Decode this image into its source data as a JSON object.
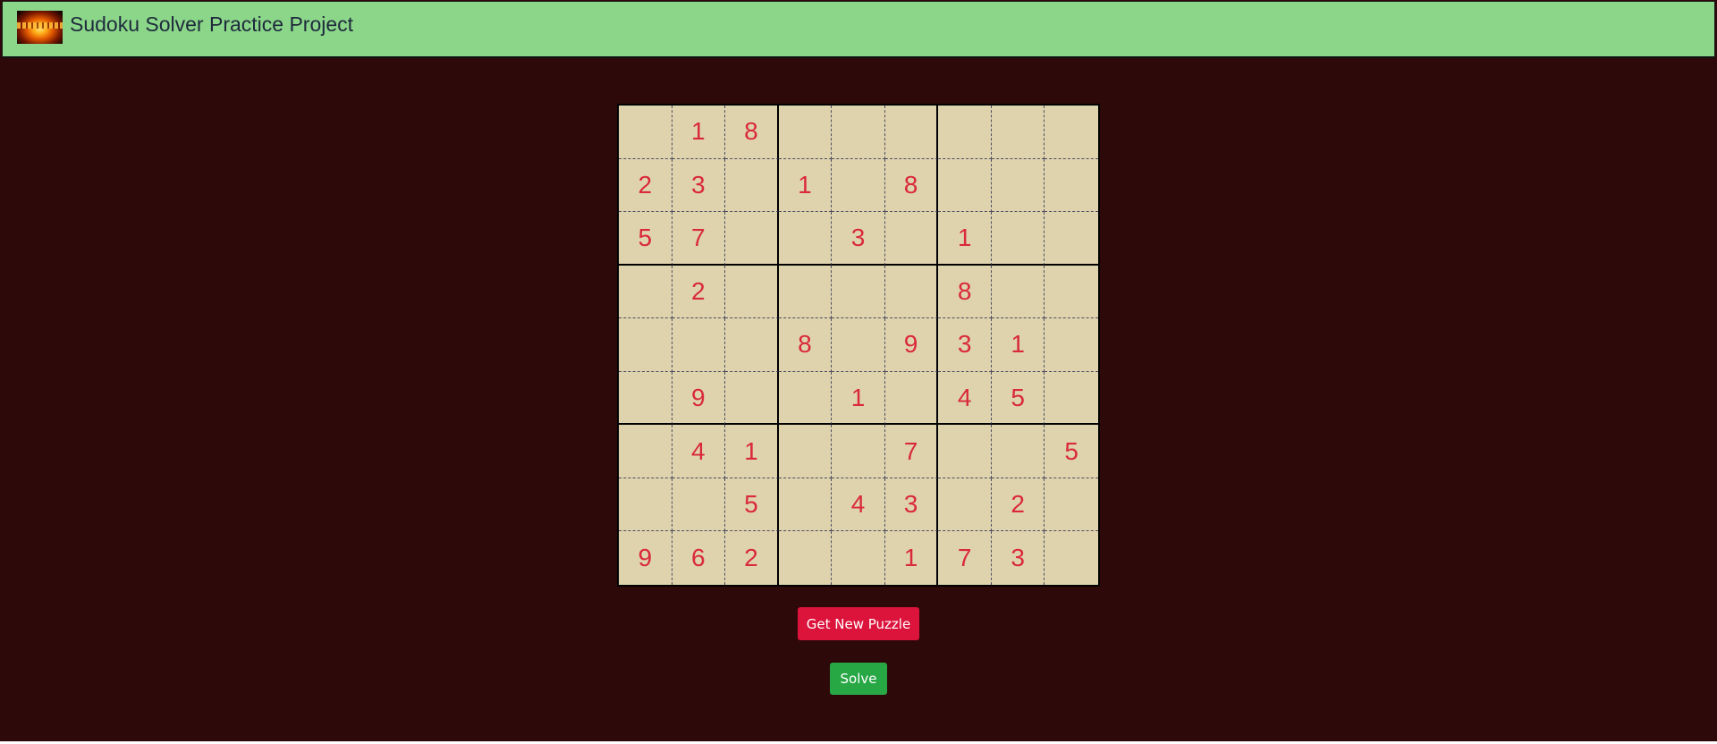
{
  "header": {
    "title": "Sudoku Solver Practice Project",
    "logo_icon": "fire-logo-icon"
  },
  "grid": [
    [
      "",
      "1",
      "8",
      "",
      "",
      "",
      "",
      "",
      ""
    ],
    [
      "2",
      "3",
      "",
      "1",
      "",
      "8",
      "",
      "",
      ""
    ],
    [
      "5",
      "7",
      "",
      "",
      "3",
      "",
      "1",
      "",
      ""
    ],
    [
      "",
      "2",
      "",
      "",
      "",
      "",
      "8",
      "",
      ""
    ],
    [
      "",
      "",
      "",
      "8",
      "",
      "9",
      "3",
      "1",
      ""
    ],
    [
      "",
      "9",
      "",
      "",
      "1",
      "",
      "4",
      "5",
      ""
    ],
    [
      "",
      "4",
      "1",
      "",
      "",
      "7",
      "",
      "",
      "5"
    ],
    [
      "",
      "",
      "5",
      "",
      "4",
      "3",
      "",
      "2",
      ""
    ],
    [
      "9",
      "6",
      "2",
      "",
      "",
      "1",
      "7",
      "3",
      ""
    ]
  ],
  "actions": {
    "new_puzzle_label": "Get New Puzzle",
    "solve_label": "Solve"
  },
  "colors": {
    "background": "#2e090a",
    "header": "#8bd689",
    "board": "#dfd3ae",
    "digit": "#d9293b",
    "new_puzzle_button": "#dc143c",
    "solve_button": "#28a745"
  }
}
